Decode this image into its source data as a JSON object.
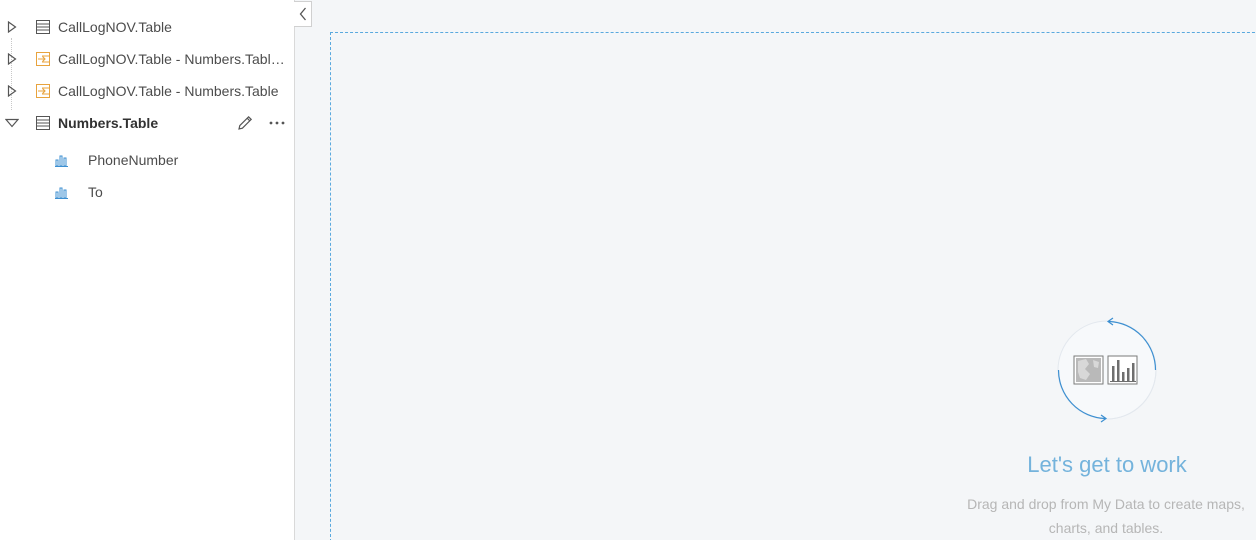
{
  "datasets": [
    {
      "label": "CallLogNOV.Table",
      "icon": "table-icon",
      "expanded": false
    },
    {
      "label": "CallLogNOV.Table - Numbers.Table...",
      "icon": "joined-table-icon",
      "expanded": false
    },
    {
      "label": "CallLogNOV.Table - Numbers.Table",
      "icon": "joined-table-icon",
      "expanded": false
    },
    {
      "label": "Numbers.Table",
      "icon": "table-icon",
      "expanded": true
    }
  ],
  "fields": [
    {
      "label": "PhoneNumber",
      "icon": "string-field-icon"
    },
    {
      "label": "To",
      "icon": "string-field-icon"
    }
  ],
  "empty_state": {
    "title": "Let's get to work",
    "description": "Drag and drop from My Data to create maps, charts, and tables."
  },
  "colors": {
    "accent": "#5aa9de",
    "joined_icon": "#e8a33d",
    "canvas_bg": "#f4f6f8"
  }
}
